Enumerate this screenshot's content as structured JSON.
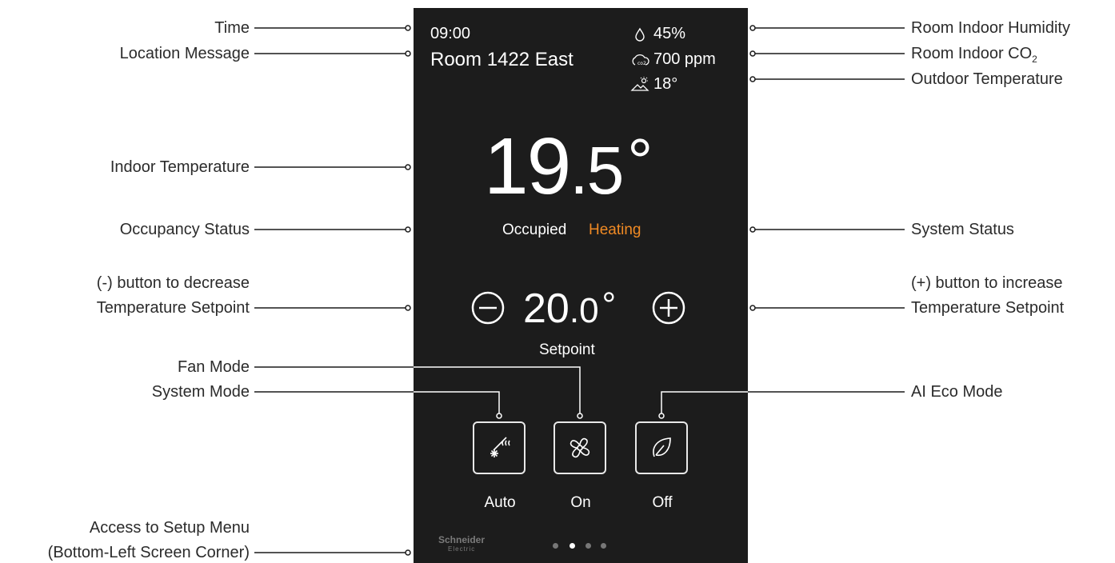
{
  "annotations": {
    "time": "Time",
    "location": "Location Message",
    "indoor_temp": "Indoor Temperature",
    "occupancy": "Occupancy Status",
    "minus_line1": "(-) button to decrease",
    "minus_line2": "Temperature Setpoint",
    "fan_mode": "Fan Mode",
    "system_mode": "System Mode",
    "setup_line1": "Access to Setup Menu",
    "setup_line2": "(Bottom-Left Screen Corner)",
    "humidity": "Room Indoor Humidity",
    "co2_prefix": "Room Indoor CO",
    "co2_sub": "2",
    "outdoor_temp": "Outdoor Temperature",
    "system_status": "System Status",
    "plus_line1": "(+) button to increase",
    "plus_line2": "Temperature Setpoint",
    "ai_eco": "AI Eco Mode"
  },
  "screen": {
    "time": "09:00",
    "location": "Room 1422 East",
    "humidity": "45%",
    "co2": "700 ppm",
    "outdoor": "18°",
    "temp_main": "19",
    "temp_decimal": ".5",
    "temp_degree": "°",
    "occupancy": "Occupied",
    "status": "Heating",
    "setpoint_main": "20",
    "setpoint_decimal": ".0",
    "setpoint_degree": "°",
    "setpoint_label": "Setpoint",
    "modes": [
      {
        "label": "Auto",
        "icon": "heat-cool-icon"
      },
      {
        "label": "On",
        "icon": "fan-icon"
      },
      {
        "label": "Off",
        "icon": "leaf-icon"
      }
    ],
    "brand": "Schneider",
    "brand_sub": "Electric",
    "page_dots": 4,
    "active_page": 2
  },
  "colors": {
    "screen_bg": "#1c1c1c",
    "status_orange": "#f08a24",
    "text_white": "#ffffff"
  }
}
